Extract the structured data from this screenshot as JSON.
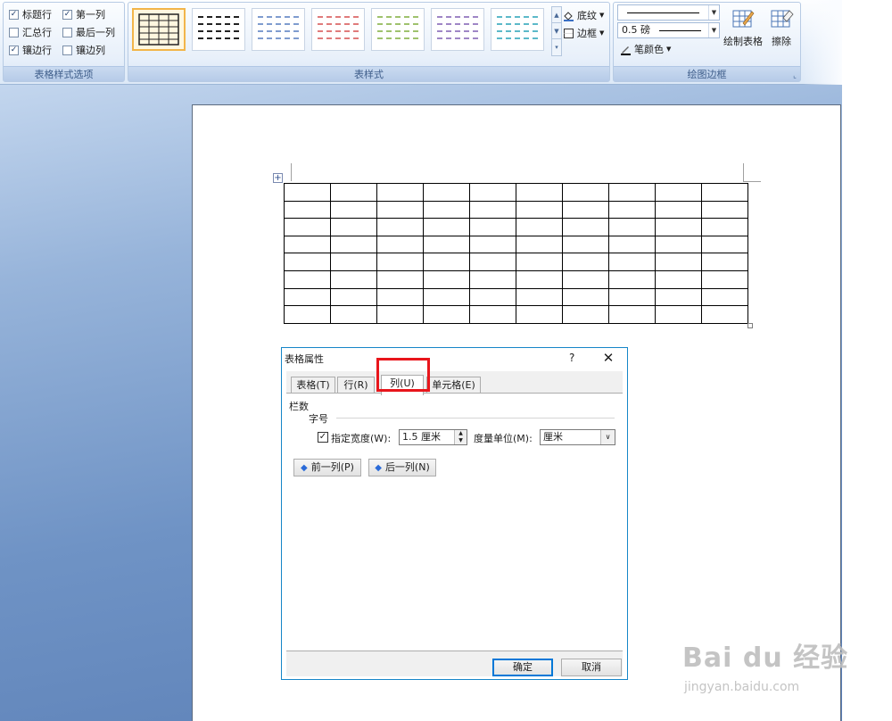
{
  "ribbon": {
    "options": {
      "label": "表格样式选项",
      "items": [
        {
          "label": "标题行",
          "checked": true
        },
        {
          "label": "第一列",
          "checked": true
        },
        {
          "label": "汇总行",
          "checked": false
        },
        {
          "label": "最后一列",
          "checked": false
        },
        {
          "label": "镶边行",
          "checked": true
        },
        {
          "label": "镶边列",
          "checked": false
        }
      ]
    },
    "styles": {
      "label": "表样式",
      "thumb_colors": [
        "#222222",
        "#222222",
        "#7f9ccf",
        "#e07b7b",
        "#9fc26d",
        "#9f86c6",
        "#5cb9c9"
      ],
      "shading_label": "底纹",
      "border_label": "边框"
    },
    "borders": {
      "label": "绘图边框",
      "weight": "0.5 磅",
      "pen_color_label": "笔颜色",
      "draw_table_label": "绘制表格",
      "eraser_label": "擦除"
    }
  },
  "dialog": {
    "title": "表格属性",
    "help": "?",
    "close": "✕",
    "tabs": [
      "表格(T)",
      "行(R)",
      "列(U)",
      "单元格(E)"
    ],
    "active_tab": "列(U)",
    "section_label": "栏数",
    "size_label": "字号",
    "width_checked": true,
    "width_label": "指定宽度(W):",
    "width_value": "1.5 厘米",
    "unit_label": "度量单位(M):",
    "unit_value": "厘米",
    "prev_col": "前一列(P)",
    "next_col": "后一列(N)",
    "ok": "确定",
    "cancel": "取消"
  },
  "watermark": {
    "brand": "Bai du 经验",
    "url": "jingyan.baidu.com"
  }
}
